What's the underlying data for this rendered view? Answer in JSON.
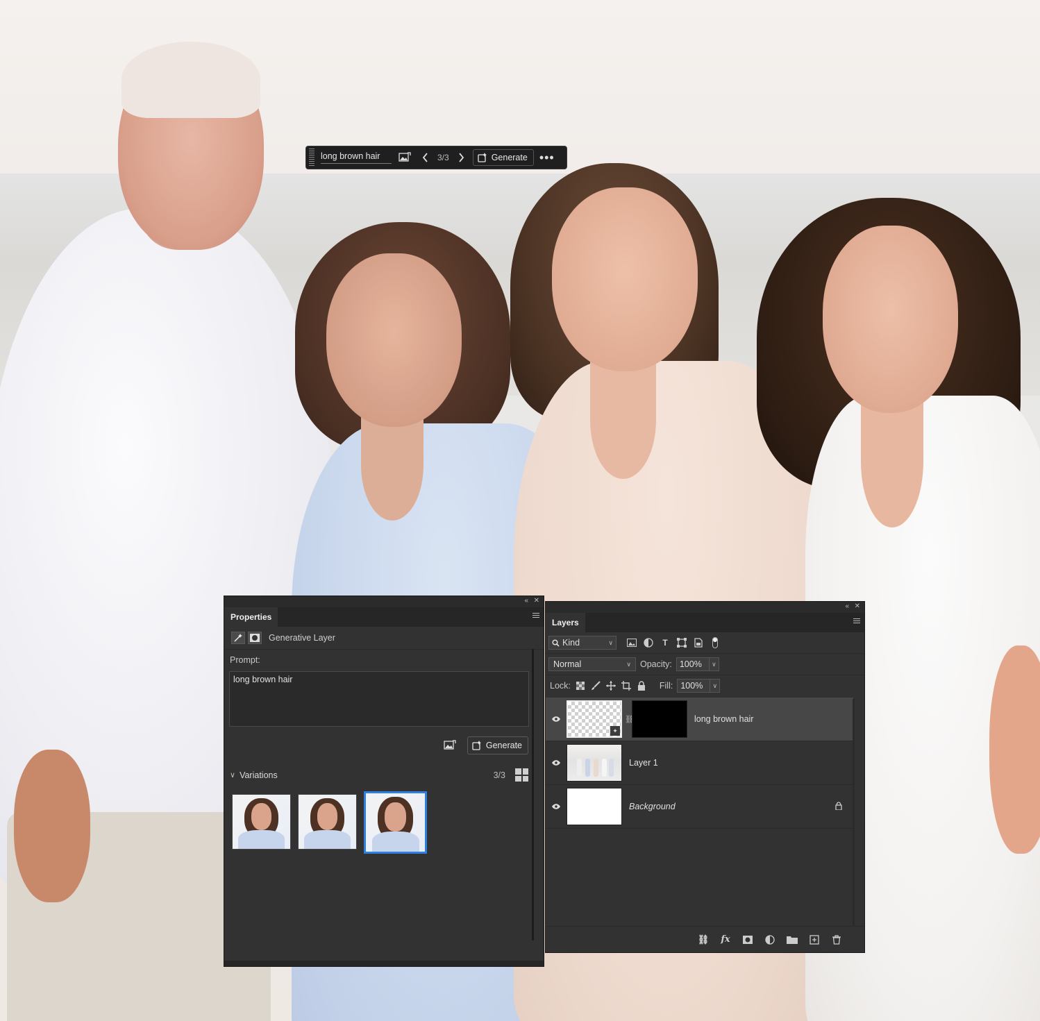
{
  "taskbar": {
    "prompt": "long brown hair",
    "count": "3/3",
    "generate_label": "Generate",
    "more_label": "•••",
    "icons": [
      "reference-image-icon",
      "chevron-left-icon",
      "chevron-right-icon",
      "generate-icon"
    ]
  },
  "properties": {
    "tab_label": "Properties",
    "layer_type": "Generative Layer",
    "prompt_label": "Prompt:",
    "prompt_value": "long brown hair",
    "generate_label": "Generate",
    "variations_label": "Variations",
    "variations_count": "3/3",
    "variations": [
      {
        "selected": false
      },
      {
        "selected": false
      },
      {
        "selected": true
      }
    ]
  },
  "layers": {
    "tab_label": "Layers",
    "filter_kind": "Kind",
    "blend_mode": "Normal",
    "opacity_label": "Opacity:",
    "opacity_value": "100%",
    "lock_label": "Lock:",
    "fill_label": "Fill:",
    "fill_value": "100%",
    "items": [
      {
        "name": "long brown hair",
        "selected": true,
        "visible": true
      },
      {
        "name": "Layer 1",
        "selected": false,
        "visible": true
      },
      {
        "name": "Background",
        "selected": false,
        "visible": true,
        "locked": true
      }
    ]
  },
  "colors": {
    "panel_bg": "#323232",
    "selection_blue": "#2f7fe0",
    "selected_row": "#474747"
  }
}
